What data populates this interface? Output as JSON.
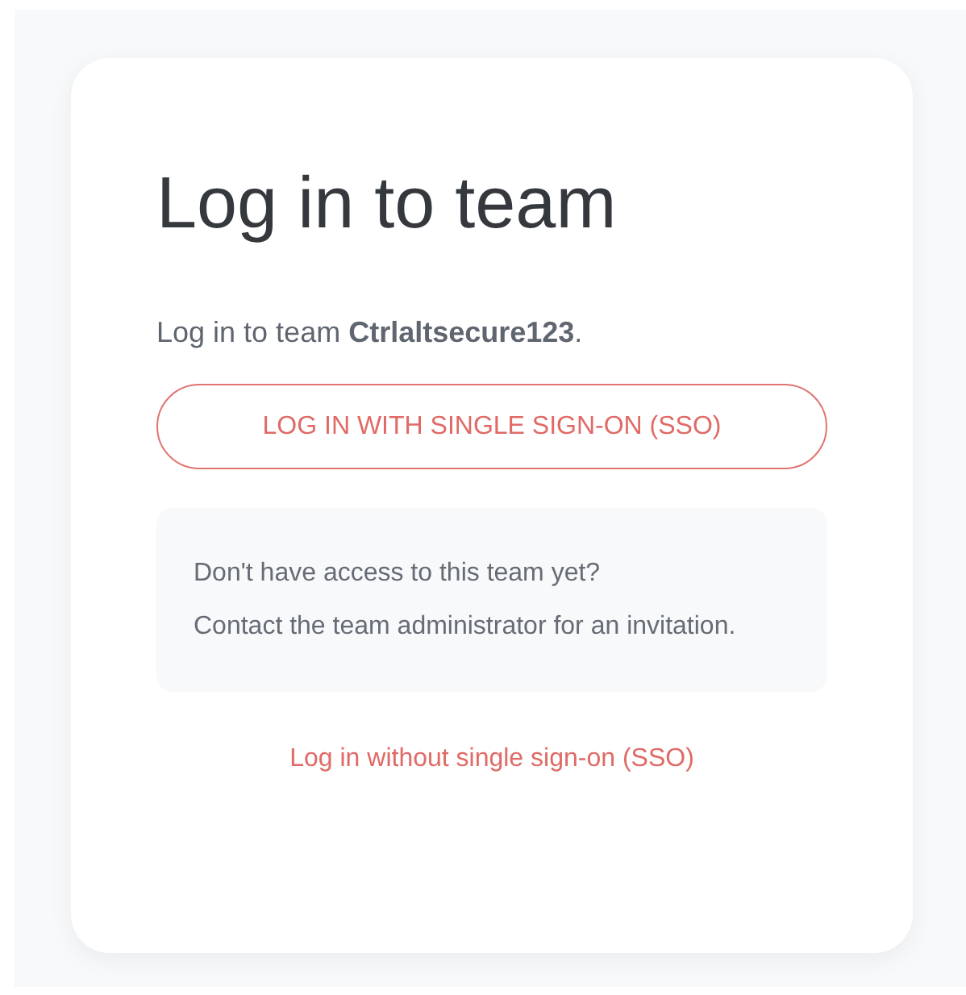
{
  "title": "Log in to team",
  "subtitle": "Log in to team **Ctrlaltsecure123**.",
  "sso_button": "LOG IN WITH SINGLE SIGN-ON (SSO)",
  "notice": [
    "Don't have access to this team yet?",
    "Contact the team administrator for an invitation."
  ],
  "alt_link": "Log in without single sign-on (SSO)"
}
